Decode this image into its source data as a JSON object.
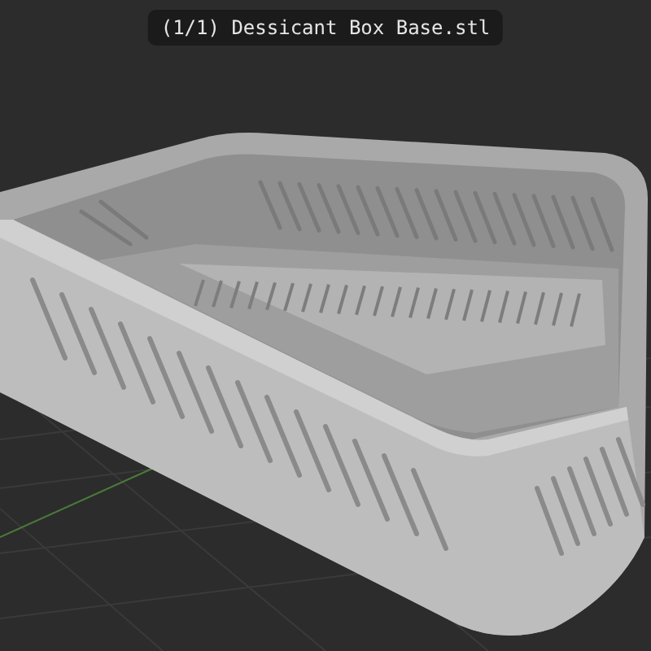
{
  "viewport": {
    "title_badge": "(1/1) Dessicant Box Base.stl"
  }
}
